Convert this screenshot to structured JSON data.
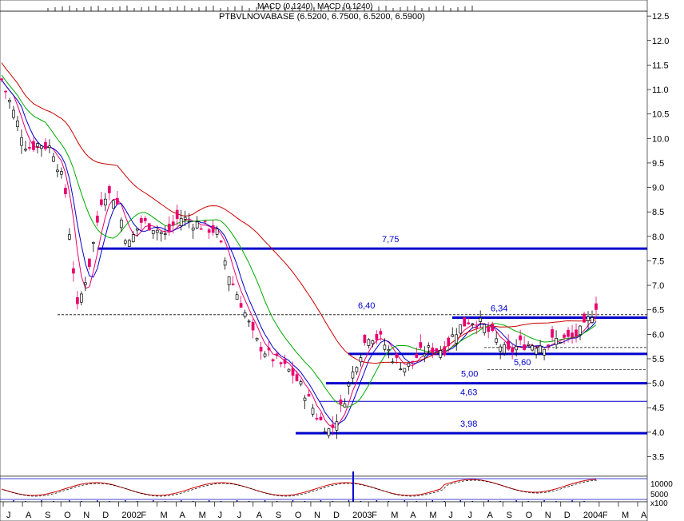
{
  "header": {
    "macd_label": "MACD (0.1240), MACD (0.1240)",
    "price_label": "PTBVLNOVABASE (6.5200, 6.7500, 6.5200, 6.5900)"
  },
  "chart_data": {
    "type": "candlestick",
    "title": "PTBVLNOVABASE",
    "ohlc_last": {
      "open": 6.52,
      "high": 6.75,
      "low": 6.52,
      "close": 6.59
    },
    "x_months": [
      "J",
      "A",
      "S",
      "O",
      "N",
      "D",
      "2002",
      "F",
      "M",
      "A",
      "M",
      "J",
      "J",
      "A",
      "S",
      "O",
      "N",
      "D",
      "2003",
      "F",
      "M",
      "A",
      "M",
      "J",
      "J",
      "A",
      "S",
      "O",
      "N",
      "D",
      "2004",
      "F",
      "M",
      "A"
    ],
    "y_ticks": [
      "12.5",
      "12.0",
      "11.5",
      "11.0",
      "10.5",
      "10.0",
      "9.5",
      "9.0",
      "8.5",
      "8.0",
      "7.5",
      "7.0",
      "6.5",
      "6.0",
      "5.5",
      "5.0",
      "4.5",
      "4.0",
      "3.5"
    ],
    "ylim": [
      3.1,
      12.6
    ],
    "levels": [
      {
        "label": "7,75",
        "value": 7.75,
        "style": "thick",
        "color": "#0000cc"
      },
      {
        "label": "6,40",
        "value": 6.4,
        "style": "dashed",
        "color": "#000000"
      },
      {
        "label": "6,34",
        "value": 6.34,
        "style": "thick",
        "color": "#0000cc"
      },
      {
        "label": "5,60",
        "value": 5.6,
        "style": "thick",
        "color": "#0000cc"
      },
      {
        "label": "5,00",
        "value": 5.0,
        "style": "thick",
        "color": "#0000cc"
      },
      {
        "label": "4,63",
        "value": 4.63,
        "style": "thin",
        "color": "#0000cc"
      },
      {
        "label": "3,98",
        "value": 3.98,
        "style": "thick",
        "color": "#0000cc"
      }
    ],
    "extra_dashed_levels": [
      5.73,
      5.28
    ],
    "price_path": [
      [
        0,
        11.2
      ],
      [
        3,
        10.5
      ],
      [
        5,
        9.8
      ],
      [
        6,
        9.9
      ],
      [
        7,
        9.8
      ],
      [
        8,
        9.0
      ],
      [
        9,
        6.5
      ],
      [
        10,
        7.5
      ],
      [
        11,
        8.9
      ],
      [
        12,
        8.8
      ],
      [
        13,
        7.8
      ],
      [
        14,
        8.3
      ],
      [
        15,
        8.2
      ],
      [
        16,
        8.0
      ],
      [
        17,
        8.4
      ],
      [
        18,
        8.3
      ],
      [
        19,
        8.2
      ],
      [
        20,
        8.1
      ],
      [
        21,
        7.2
      ],
      [
        22,
        6.6
      ],
      [
        23,
        5.9
      ],
      [
        24,
        5.6
      ],
      [
        25,
        5.4
      ],
      [
        26,
        5.2
      ],
      [
        27,
        4.8
      ],
      [
        28,
        4.3
      ],
      [
        29,
        4.0
      ],
      [
        30,
        4.6
      ],
      [
        31,
        5.4
      ],
      [
        32,
        6.0
      ],
      [
        33,
        5.9
      ],
      [
        34,
        5.5
      ],
      [
        35,
        5.3
      ],
      [
        36,
        5.6
      ],
      [
        37,
        5.7
      ],
      [
        38,
        5.7
      ],
      [
        39,
        6.1
      ],
      [
        40,
        6.3
      ],
      [
        41,
        6.2
      ],
      [
        42,
        5.9
      ],
      [
        43,
        5.6
      ],
      [
        44,
        5.8
      ],
      [
        45,
        5.8
      ],
      [
        46,
        5.8
      ],
      [
        47,
        5.9
      ],
      [
        48,
        5.9
      ],
      [
        49,
        6.1
      ],
      [
        50,
        6.6
      ]
    ],
    "bottom_ticks": [
      "10000",
      "5000",
      "x100"
    ],
    "colors": {
      "up": "#000000",
      "down": "#e8006e",
      "ma_fast": "#0000cc",
      "ma_mid": "#00aa00",
      "ma_slow": "#cc0000",
      "level": "#0000cc",
      "macd": "#cc0000"
    }
  }
}
